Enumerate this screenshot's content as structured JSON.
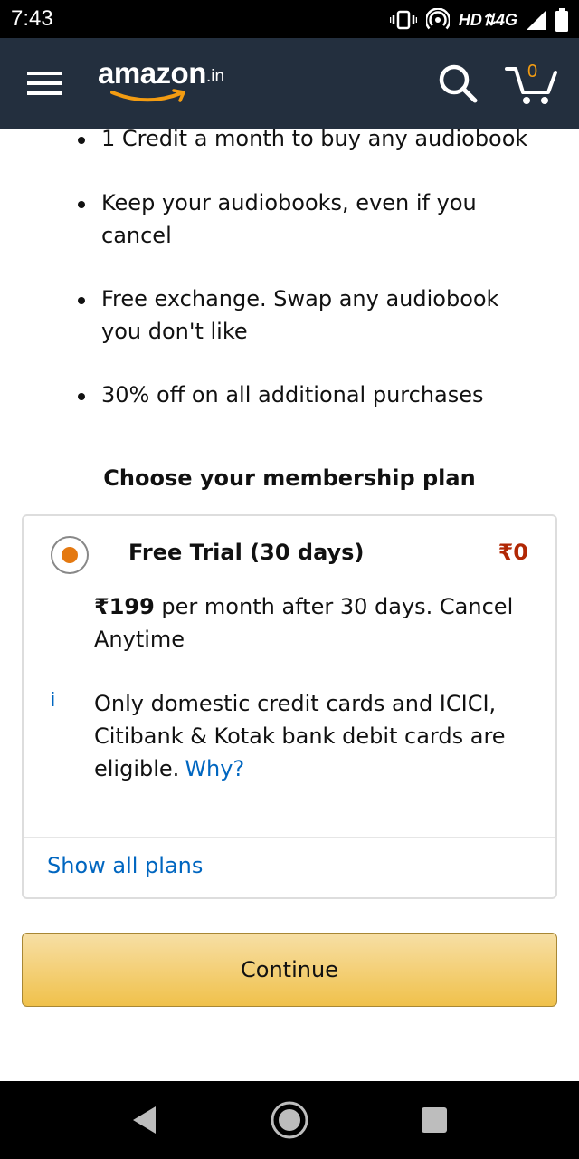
{
  "status_bar": {
    "time": "7:43",
    "network": "HD",
    "signal": "4G",
    "icons": [
      "vibrate-icon",
      "hotspot-icon",
      "signal-icon",
      "battery-icon"
    ]
  },
  "header": {
    "logo_text": "amazon",
    "logo_suffix": ".in",
    "cart_count": "0",
    "icons": [
      "hamburger-menu-icon",
      "search-icon",
      "cart-icon"
    ],
    "background_color": "#232f3e",
    "accent_color": "#f39c12"
  },
  "benefits": [
    "1 Credit a month to buy any audiobook",
    "Keep your audiobooks, even if you cancel",
    "Free exchange. Swap any audiobook you don't like",
    "30% off on all additional purchases"
  ],
  "plans_heading": "Choose your membership plan",
  "plan": {
    "selected": true,
    "name": "Free Trial (30 days)",
    "price": "₹0",
    "renewal_price": "₹199",
    "renewal_text": " per month after 30 days. Cancel Anytime",
    "note": "Only domestic credit cards and ICICI, Citibank & Kotak bank debit cards are eligible.",
    "why_link": "Why?",
    "info_icon": "i",
    "price_color": "#b12704",
    "radio_color": "#e47911"
  },
  "show_all_plans": "Show all plans",
  "continue_label": "Continue",
  "nav_bar": {
    "icons": [
      "back-icon",
      "home-icon",
      "recents-icon"
    ]
  }
}
